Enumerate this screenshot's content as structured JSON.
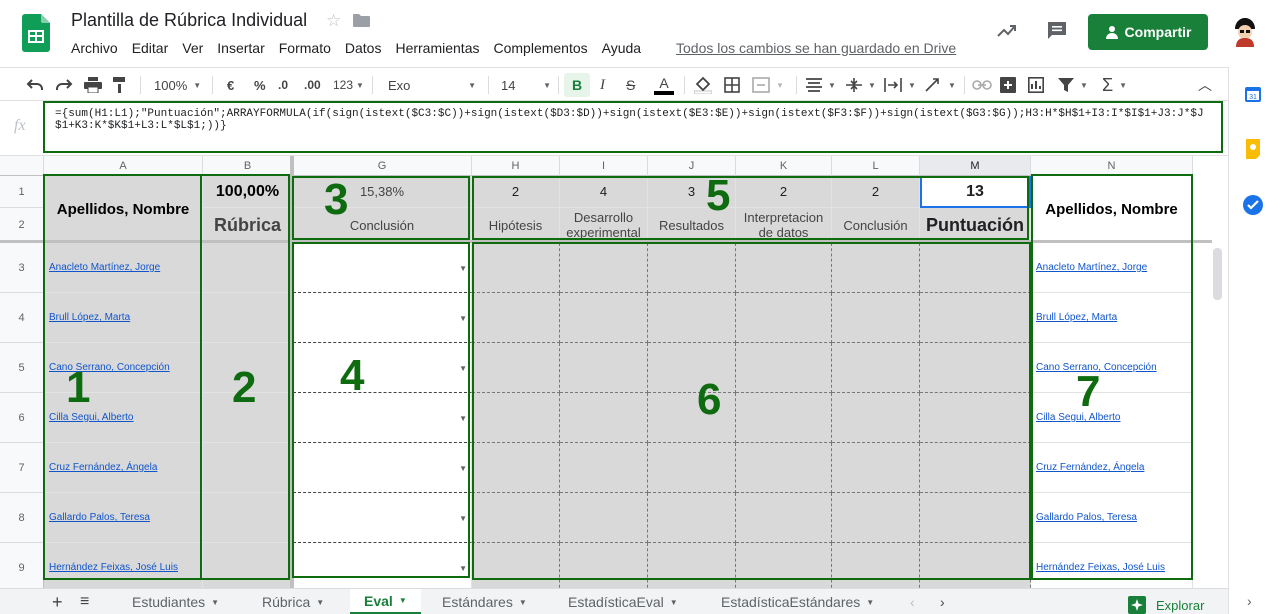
{
  "header": {
    "title": "Plantilla de Rúbrica Individual",
    "saved_status": "Todos los cambios se han guardado en Drive",
    "share_label": "Compartir",
    "menu": [
      "Archivo",
      "Editar",
      "Ver",
      "Insertar",
      "Formato",
      "Datos",
      "Herramientas",
      "Complementos",
      "Ayuda"
    ]
  },
  "toolbar": {
    "zoom": "100%",
    "currency": "€",
    "percent": "%",
    "dec_less": ".0",
    "dec_more": ".00",
    "more_formats": "123",
    "font": "Exo",
    "font_size": "14",
    "bold": "B"
  },
  "formula_bar": {
    "fx_label": "fx",
    "formula": "={sum(H1:L1);\"Puntuación\";ARRAYFORMULA(if(sign(istext($C3:$C))+sign(istext($D3:$D))+sign(istext($E3:$E))+sign(istext($F3:$F))+sign(istext($G3:$G));H3:H*$H$1+I3:I*$I$1+J3:J*$J$1+K3:K*$K$1+L3:L*$L$1;))}"
  },
  "grid": {
    "columns": [
      "A",
      "B",
      "G",
      "H",
      "I",
      "J",
      "K",
      "L",
      "M",
      "N"
    ],
    "rows": [
      "1",
      "2",
      "3",
      "4",
      "5",
      "6",
      "7",
      "8",
      "9"
    ],
    "a_header": "Apellidos, Nombre",
    "b_pct": "100,00%",
    "b_label": "Rúbrica",
    "g_pct": "15,38%",
    "g_label": "Conclusión",
    "weights": {
      "H": "2",
      "I": "4",
      "J": "3",
      "K": "2",
      "L": "2",
      "M": "13"
    },
    "criteria": {
      "H": "Hipótesis",
      "I": "Desarrollo experimental",
      "J": "Resultados",
      "K": "Interpretacion de datos",
      "L": "Conclusión",
      "M": "Puntuación"
    },
    "n_header": "Apellidos, Nombre",
    "students": [
      "Anacleto Martínez, Jorge",
      "Brull López, Marta",
      "Cano Serrano, Concepción",
      "Cilla Segui, Alberto",
      "Cruz Fernández, Ángela",
      "Gallardo Palos, Teresa",
      "Hernández Feixas, José Luis"
    ]
  },
  "annotations": [
    "1",
    "2",
    "3",
    "4",
    "5",
    "6",
    "7"
  ],
  "sheet_tabs": [
    "Estudiantes",
    "Rúbrica",
    "Eval",
    "Estándares",
    "EstadísticaEval",
    "EstadísticaEstándares"
  ],
  "active_tab": "Eval",
  "explore_label": "Explorar",
  "colors": {
    "brand_green": "#188038",
    "annotation_green": "#0f6b0f",
    "cell_gray": "#d9d9d9",
    "link_blue": "#1155cc"
  }
}
